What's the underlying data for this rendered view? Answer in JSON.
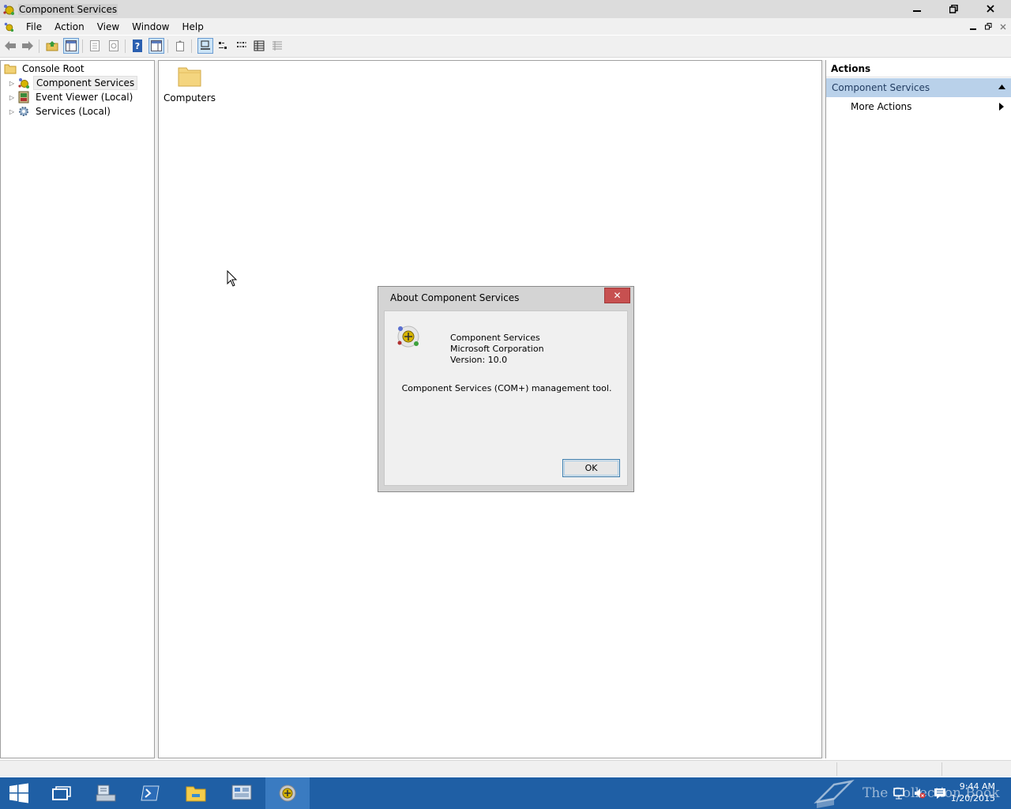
{
  "window": {
    "title": "Component Services"
  },
  "menubar": {
    "items": [
      "File",
      "Action",
      "View",
      "Window",
      "Help"
    ]
  },
  "toolbar": {
    "icons": [
      "back-arrow-icon",
      "forward-arrow-icon",
      "up-folder-icon",
      "show-hide-tree-icon",
      "properties-icon",
      "refresh-icon",
      "help-icon",
      "show-hide-action-pane-icon",
      "export-list-icon",
      "large-icons-view-icon",
      "small-icons-view-icon",
      "list-view-icon",
      "detail-view-icon",
      "status-view-icon"
    ]
  },
  "tree": {
    "root": "Console Root",
    "items": [
      {
        "label": "Component Services",
        "icon": "component-services-icon",
        "selected": true
      },
      {
        "label": "Event Viewer (Local)",
        "icon": "event-viewer-icon",
        "selected": false
      },
      {
        "label": "Services (Local)",
        "icon": "services-gear-icon",
        "selected": false
      }
    ]
  },
  "content": {
    "items": [
      {
        "label": "Computers",
        "icon": "folder-icon"
      }
    ]
  },
  "actions": {
    "header": "Actions",
    "section": "Component Services",
    "items": [
      "More Actions"
    ]
  },
  "dialog": {
    "title": "About Component Services",
    "close_label": "✕",
    "product": "Component Services",
    "company": "Microsoft Corporation",
    "version": "Version: 10.0",
    "description": "Component Services (COM+) management tool.",
    "ok_label": "OK"
  },
  "taskbar": {
    "time": "9:44 AM",
    "date": "1/20/2015",
    "watermark": "The Collection Book",
    "colors": {
      "background": "#1f5fa5",
      "active": "#3a7bc1"
    }
  }
}
